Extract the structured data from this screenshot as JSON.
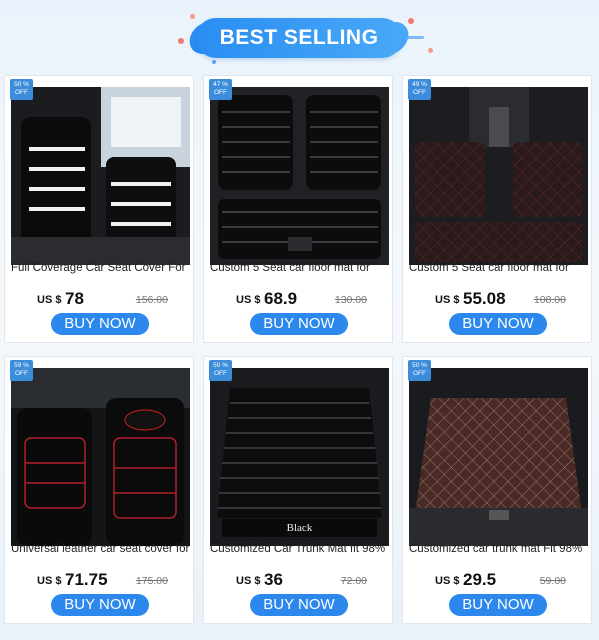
{
  "header": {
    "title": "BEST SELLING"
  },
  "products": [
    {
      "badge_pct": "50 %",
      "badge_off": "OFF",
      "title": "Full Coverage Car Seat Cover For",
      "currency": "US $",
      "price": "78",
      "original_price": "156.00",
      "buy_label": "BUY NOW",
      "image": "black-white-car-seat-covers"
    },
    {
      "badge_pct": "47 %",
      "badge_off": "OFF",
      "title": "Custom 5 Seat car floor mat for",
      "currency": "US $",
      "price": "68.9",
      "original_price": "130.00",
      "buy_label": "BUY NOW",
      "image": "black-striped-floor-mats"
    },
    {
      "badge_pct": "49 %",
      "badge_off": "OFF",
      "title": "Custom 5 Seat car floor mat for",
      "currency": "US $",
      "price": "55.08",
      "original_price": "108.00",
      "buy_label": "BUY NOW",
      "image": "brown-diamond-floor-mats"
    },
    {
      "badge_pct": "59 %",
      "badge_off": "OFF",
      "title": "Universal leather car seat cover for",
      "currency": "US $",
      "price": "71.75",
      "original_price": "175.00",
      "buy_label": "BUY NOW",
      "image": "black-red-leather-seat-covers"
    },
    {
      "badge_pct": "50 %",
      "badge_off": "OFF",
      "title": "Customized Car Trunk Mat fit 98%",
      "currency": "US $",
      "price": "36",
      "original_price": "72.00",
      "buy_label": "BUY NOW",
      "image": "black-trunk-mat",
      "image_caption": "Black"
    },
    {
      "badge_pct": "50 %",
      "badge_off": "OFF",
      "title": "Customized car trunk mat Fit 98%",
      "currency": "US $",
      "price": "29.5",
      "original_price": "59.00",
      "buy_label": "BUY NOW",
      "image": "brown-diamond-trunk-mat"
    }
  ]
}
